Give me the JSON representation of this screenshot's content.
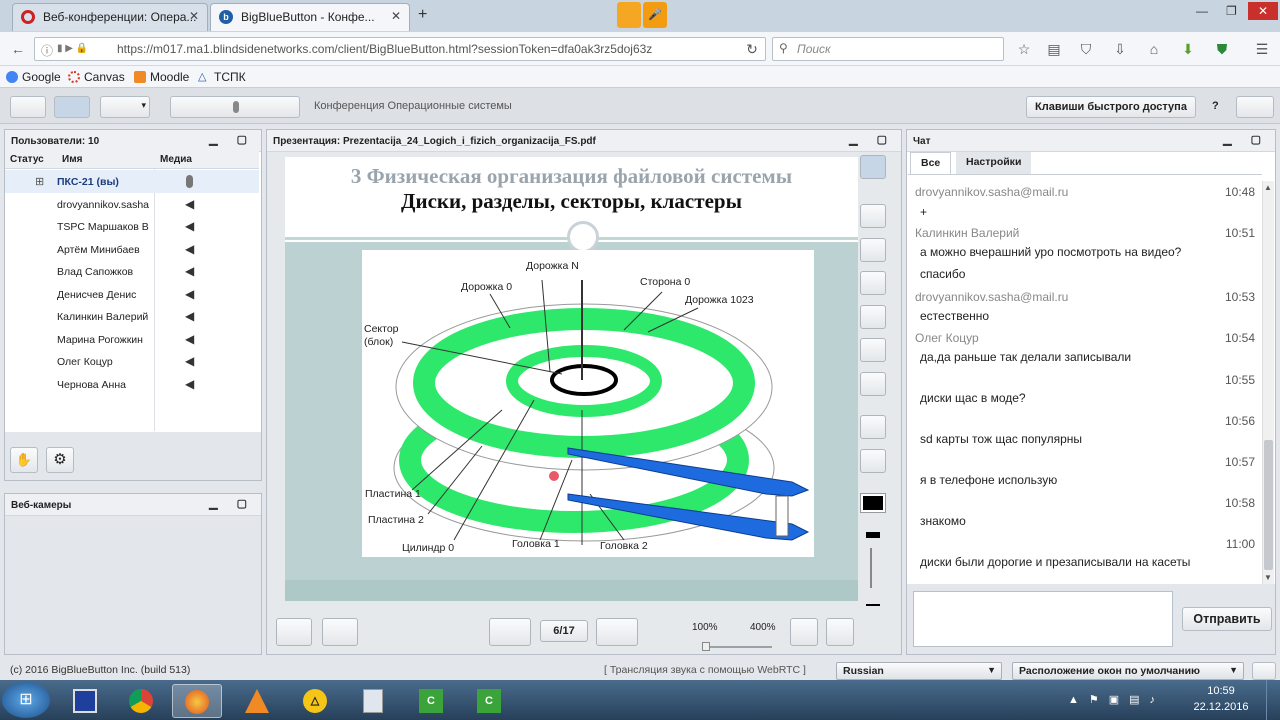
{
  "browser": {
    "tabs": [
      {
        "label": "Веб-конференции: Опера...",
        "icon": "opera-icon"
      },
      {
        "label": "BigBlueButton - Конфе...",
        "icon": "bbb-icon"
      }
    ],
    "url": "https://m017.ma1.blindsidenetworks.com/client/BigBlueButton.html?sessionToken=dfa0ak3rz5doj63z",
    "search_placeholder": "Поиск",
    "bookmarks": [
      "Google",
      "Canvas",
      "Moodle",
      "ТСПК"
    ]
  },
  "toolbar": {
    "conference_title": "Конференция Операционные системы",
    "shortcut_button": "Клавиши быстрого доступа",
    "help": "?"
  },
  "users": {
    "title": "Пользователи: 10",
    "columns": [
      "Статус",
      "Имя",
      "Медиа"
    ],
    "list": [
      "ПКС-21 (вы)",
      "drovyannikov.sasha",
      "TSPC Маршаков В",
      "Артём Минибаев",
      "Влад Сапожков",
      "Денисчев Денис",
      "Калинкин Валерий",
      "Марина Рогожкин",
      "Олег Коцур",
      "Чернова Анна"
    ]
  },
  "webcams": {
    "title": "Веб-камеры"
  },
  "presentation": {
    "title": "Презентация: Prezentacija_24_Logich_i_fizich_organizacija_FS.pdf",
    "slide_title": "3 Физическая организация файловой системы",
    "slide_subtitle": "Диски, разделы, секторы, кластеры",
    "labels": {
      "track_n": "Дорожка N",
      "track_0": "Дорожка 0",
      "side_0": "Сторона 0",
      "track_1023": "Дорожка 1023",
      "sector": "Сектор",
      "block": "(блок)",
      "plate1": "Пластина 1",
      "plate2": "Пластина 2",
      "cylinder": "Цилиндр 0",
      "head1": "Головка 1",
      "head2": "Головка 2"
    },
    "page": "6/17",
    "zoom_min": "100%",
    "zoom_max": "400%"
  },
  "chat": {
    "title": "Чат",
    "tabs": [
      "Все",
      "Настройки"
    ],
    "messages": [
      {
        "name": "drovyannikov.sasha@mail.ru",
        "time": "10:48",
        "lines": [
          "+"
        ]
      },
      {
        "name": "Калинкин Валерий",
        "time": "10:51",
        "lines": [
          "а можно вчерашний уро посмотроть на видео?",
          "спасибо"
        ]
      },
      {
        "name": "drovyannikov.sasha@mail.ru",
        "time": "10:53",
        "lines": [
          "естественно"
        ]
      },
      {
        "name": "Олег Коцур",
        "time": "10:54",
        "lines": [
          "да,да раньше так делали записывали"
        ]
      },
      {
        "name": "",
        "time": "10:55",
        "lines": [
          "диски щас в моде?"
        ]
      },
      {
        "name": "",
        "time": "10:56",
        "lines": [
          "sd карты тож щас популярны"
        ]
      },
      {
        "name": "",
        "time": "10:57",
        "lines": [
          "я в телефоне использую"
        ]
      },
      {
        "name": "",
        "time": "10:58",
        "lines": [
          "знакомо"
        ]
      },
      {
        "name": "",
        "time": "11:00",
        "lines": [
          "диски были дорогие и презаписывали на касеты"
        ]
      }
    ],
    "send_button": "Отправить"
  },
  "statusbar": {
    "copyright": "(c) 2016 BigBlueButton Inc. (build 513)",
    "webrtc": "[ Трансляция звука с помощью WebRTC ]",
    "language": "Russian",
    "layout": "Расположение окон по умолчанию"
  },
  "taskbar": {
    "time": "10:59",
    "date": "22.12.2016"
  }
}
